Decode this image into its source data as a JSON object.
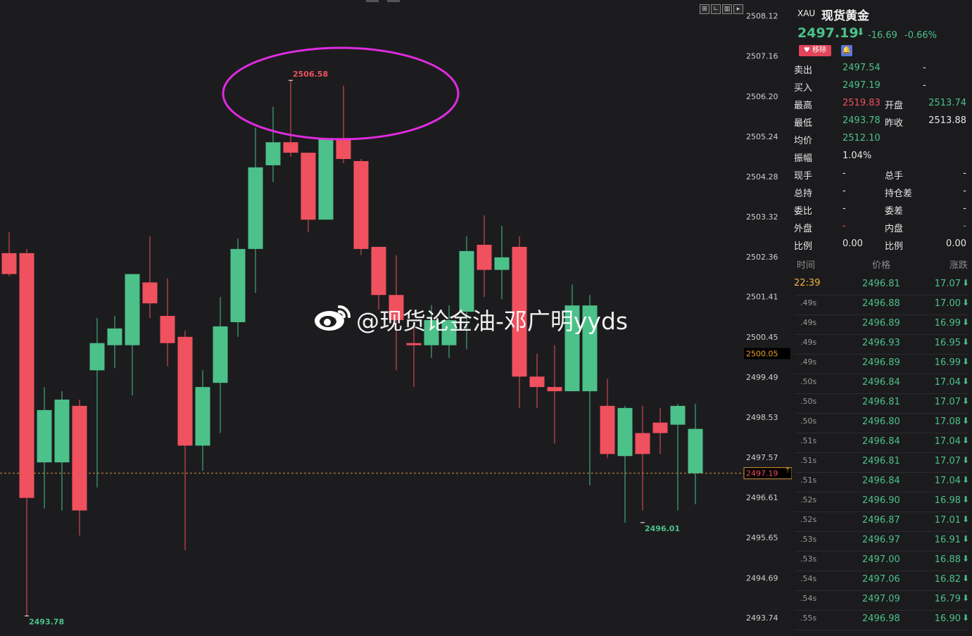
{
  "symbol": {
    "code": "XAU",
    "name": "现货黄金",
    "last": "2497.19",
    "arrow": "⬇",
    "change": "-16.69",
    "change_pct": "-0.66%",
    "fav_label": "移除"
  },
  "quote_rows": [
    {
      "l1": "卖出",
      "v1": "2497.54",
      "c1": "green",
      "l2": "",
      "v2": "",
      "c2": "white",
      "d": "-"
    },
    {
      "l1": "买入",
      "v1": "2497.19",
      "c1": "green",
      "l2": "",
      "v2": "",
      "c2": "white",
      "d": "-"
    },
    {
      "l1": "最高",
      "v1": "2519.83",
      "c1": "red",
      "l2": "开盘",
      "v2": "2513.74",
      "c2": "green",
      "d": ""
    },
    {
      "l1": "最低",
      "v1": "2493.78",
      "c1": "green",
      "l2": "昨收",
      "v2": "2513.88",
      "c2": "white",
      "d": ""
    },
    {
      "l1": "均价",
      "v1": "2512.10",
      "c1": "green",
      "l2": "",
      "v2": "",
      "c2": "white",
      "d": ""
    },
    {
      "l1": "振幅",
      "v1": "1.04%",
      "c1": "white",
      "l2": "",
      "v2": "",
      "c2": "white",
      "d": ""
    },
    {
      "l1": "现手",
      "v1": "-",
      "c1": "white",
      "l2": "总手",
      "v2": "-",
      "c2": "white",
      "d": ""
    },
    {
      "l1": "总持",
      "v1": "-",
      "c1": "white",
      "l2": "持仓差",
      "v2": "-",
      "c2": "white",
      "d": ""
    },
    {
      "l1": "委比",
      "v1": "-",
      "c1": "white",
      "l2": "委差",
      "v2": "-",
      "c2": "white",
      "d": ""
    },
    {
      "l1": "外盘",
      "v1": "-",
      "c1": "red",
      "l2": "内盘",
      "v2": "-",
      "c2": "green",
      "d": ""
    },
    {
      "l1": "比例",
      "v1": "0.00",
      "c1": "white",
      "l2": "比例",
      "v2": "0.00",
      "c2": "white",
      "d": ""
    }
  ],
  "ticks_header": {
    "time": "时间",
    "price": "价格",
    "change": "涨跌"
  },
  "ticks": [
    {
      "time": "22:39",
      "price": "2496.81",
      "chg": "17.07"
    },
    {
      "time": ".49s",
      "price": "2496.88",
      "chg": "17.00"
    },
    {
      "time": ".49s",
      "price": "2496.89",
      "chg": "16.99"
    },
    {
      "time": ".49s",
      "price": "2496.93",
      "chg": "16.95"
    },
    {
      "time": ".49s",
      "price": "2496.89",
      "chg": "16.99"
    },
    {
      "time": ".50s",
      "price": "2496.84",
      "chg": "17.04"
    },
    {
      "time": ".50s",
      "price": "2496.81",
      "chg": "17.07"
    },
    {
      "time": ".50s",
      "price": "2496.80",
      "chg": "17.08"
    },
    {
      "time": ".51s",
      "price": "2496.84",
      "chg": "17.04"
    },
    {
      "time": ".51s",
      "price": "2496.81",
      "chg": "17.07"
    },
    {
      "time": ".51s",
      "price": "2496.84",
      "chg": "17.04"
    },
    {
      "time": ".52s",
      "price": "2496.90",
      "chg": "16.98"
    },
    {
      "time": ".52s",
      "price": "2496.87",
      "chg": "17.01"
    },
    {
      "time": ".53s",
      "price": "2496.97",
      "chg": "16.91"
    },
    {
      "time": ".53s",
      "price": "2497.00",
      "chg": "16.88"
    },
    {
      "time": ".54s",
      "price": "2497.06",
      "chg": "16.82"
    },
    {
      "time": ".54s",
      "price": "2497.09",
      "chg": "16.79"
    },
    {
      "time": ".55s",
      "price": "2496.98",
      "chg": "16.90"
    }
  ],
  "tick_arrow": "⬇",
  "watermark": "@现货论金油-邓广明yyds",
  "chart_data": {
    "type": "candlestick",
    "y_ticks": [
      "2508.12",
      "2507.16",
      "2506.20",
      "2505.24",
      "2504.28",
      "2503.32",
      "2502.36",
      "2501.41",
      "2500.45",
      "2499.49",
      "2498.53",
      "2497.57",
      "2496.61",
      "2495.65",
      "2494.69",
      "2493.74"
    ],
    "ylim": [
      2493.3,
      2508.5
    ],
    "crosshair_label": "2500.05",
    "last_price_label": "2497.19",
    "last_price": 2497.19,
    "high_annotation": {
      "label": "2506.58",
      "value": 2506.58,
      "index": 16
    },
    "low_annotation_left": {
      "label": "2493.78",
      "value": 2493.78,
      "index": 1
    },
    "low_annotation_right": {
      "label": "2496.01",
      "value": 2496.01,
      "index": 36
    },
    "up_color": "#4cc18a",
    "down_color": "#f0515f",
    "candles": [
      {
        "o": 2502.45,
        "c": 2501.95,
        "h": 2502.95,
        "l": 2501.9
      },
      {
        "o": 2502.45,
        "c": 2496.6,
        "h": 2502.55,
        "l": 2493.78
      },
      {
        "o": 2497.45,
        "c": 2498.7,
        "h": 2499.25,
        "l": 2496.35
      },
      {
        "o": 2497.45,
        "c": 2498.95,
        "h": 2499.15,
        "l": 2496.3
      },
      {
        "o": 2498.8,
        "c": 2496.3,
        "h": 2498.95,
        "l": 2495.7
      },
      {
        "o": 2499.65,
        "c": 2500.3,
        "h": 2500.9,
        "l": 2496.85
      },
      {
        "o": 2500.25,
        "c": 2500.65,
        "h": 2500.95,
        "l": 2499.7
      },
      {
        "o": 2500.25,
        "c": 2501.95,
        "h": 2501.95,
        "l": 2499.05
      },
      {
        "o": 2501.75,
        "c": 2501.25,
        "h": 2502.85,
        "l": 2500.9
      },
      {
        "o": 2500.95,
        "c": 2500.3,
        "h": 2501.85,
        "l": 2499.75
      },
      {
        "o": 2500.45,
        "c": 2497.85,
        "h": 2500.6,
        "l": 2495.35
      },
      {
        "o": 2497.85,
        "c": 2499.25,
        "h": 2499.65,
        "l": 2497.25
      },
      {
        "o": 2499.35,
        "c": 2500.7,
        "h": 2501.4,
        "l": 2498.15
      },
      {
        "o": 2500.8,
        "c": 2502.55,
        "h": 2502.8,
        "l": 2500.45
      },
      {
        "o": 2502.55,
        "c": 2504.5,
        "h": 2505.45,
        "l": 2501.5
      },
      {
        "o": 2504.55,
        "c": 2505.1,
        "h": 2505.95,
        "l": 2504.15
      },
      {
        "o": 2505.1,
        "c": 2504.85,
        "h": 2506.58,
        "l": 2504.75
      },
      {
        "o": 2504.85,
        "c": 2503.25,
        "h": 2504.85,
        "l": 2502.95
      },
      {
        "o": 2503.25,
        "c": 2505.2,
        "h": 2505.2,
        "l": 2503.25
      },
      {
        "o": 2505.2,
        "c": 2504.7,
        "h": 2506.45,
        "l": 2504.6
      },
      {
        "o": 2504.65,
        "c": 2502.55,
        "h": 2504.7,
        "l": 2502.4
      },
      {
        "o": 2502.6,
        "c": 2501.45,
        "h": 2502.6,
        "l": 2501.1
      },
      {
        "o": 2501.45,
        "c": 2500.85,
        "h": 2502.4,
        "l": 2499.65
      },
      {
        "o": 2500.3,
        "c": 2500.25,
        "h": 2500.8,
        "l": 2499.25
      },
      {
        "o": 2500.25,
        "c": 2500.85,
        "h": 2501.2,
        "l": 2499.95
      },
      {
        "o": 2500.25,
        "c": 2500.85,
        "h": 2501.2,
        "l": 2499.95
      },
      {
        "o": 2501.05,
        "c": 2502.5,
        "h": 2502.85,
        "l": 2500.15
      },
      {
        "o": 2502.65,
        "c": 2502.05,
        "h": 2503.35,
        "l": 2501.4
      },
      {
        "o": 2502.05,
        "c": 2502.35,
        "h": 2503.1,
        "l": 2501.35
      },
      {
        "o": 2502.6,
        "c": 2499.5,
        "h": 2502.85,
        "l": 2498.75
      },
      {
        "o": 2499.5,
        "c": 2499.25,
        "h": 2500.05,
        "l": 2498.75
      },
      {
        "o": 2499.25,
        "c": 2499.15,
        "h": 2500.25,
        "l": 2497.9
      },
      {
        "o": 2499.15,
        "c": 2501.2,
        "h": 2501.7,
        "l": 2499.15
      },
      {
        "o": 2499.15,
        "c": 2501.2,
        "h": 2501.45,
        "l": 2496.9
      },
      {
        "o": 2498.8,
        "c": 2497.65,
        "h": 2499.45,
        "l": 2497.55
      },
      {
        "o": 2497.6,
        "c": 2498.75,
        "h": 2498.8,
        "l": 2496.01
      },
      {
        "o": 2498.15,
        "c": 2497.65,
        "h": 2498.8,
        "l": 2496.3
      },
      {
        "o": 2498.4,
        "c": 2498.15,
        "h": 2498.75,
        "l": 2497.65
      },
      {
        "o": 2498.35,
        "c": 2498.8,
        "h": 2498.85,
        "l": 2496.3
      },
      {
        "o": 2497.19,
        "c": 2498.25,
        "h": 2498.85,
        "l": 2496.45
      }
    ]
  }
}
